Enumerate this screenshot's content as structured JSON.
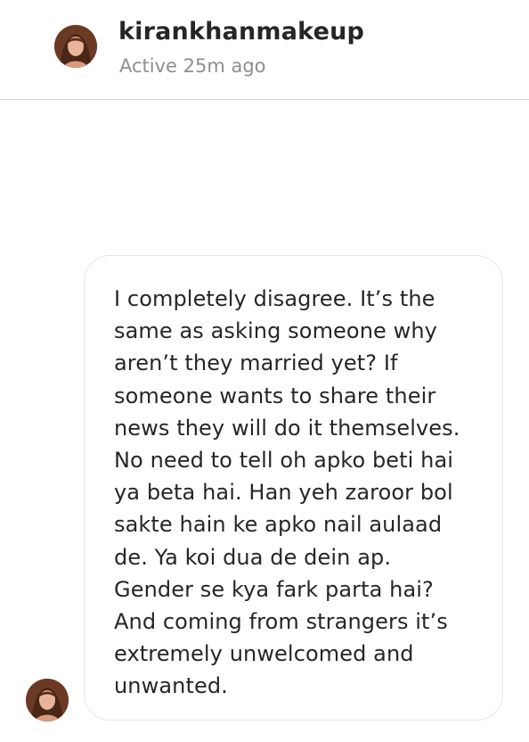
{
  "header": {
    "username": "kirankhanmakeup",
    "status": "Active 25m ago",
    "avatar_icon": "profile-photo-icon"
  },
  "conversation": {
    "messages": [
      {
        "sender": "kirankhanmakeup",
        "text": "I completely disagree. It’s the\nsame as asking someone why\naren’t they married yet? If\nsomeone wants to share their\nnews they will do it themselves.\nNo need to tell oh apko beti hai\nya beta hai. Han yeh zaroor bol\nsakte hain ke apko nail aulaad\nde. Ya koi dua de dein ap.\nGender se kya fark parta hai?\nAnd coming from strangers it’s\nextremely unwelcomed and\nunwanted."
      }
    ]
  },
  "colors": {
    "text_primary": "#262626",
    "text_secondary": "#8e8e8e",
    "divider": "#dbdbdb",
    "bubble_border": "#e6e6e6"
  }
}
